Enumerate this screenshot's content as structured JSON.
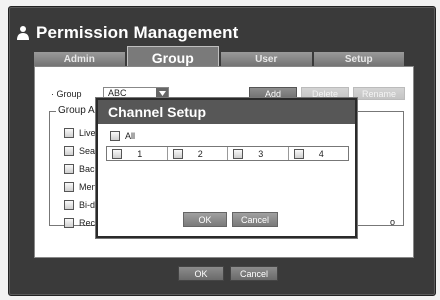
{
  "title": "Permission Management",
  "tabs": [
    "Admin",
    "Group",
    "User",
    "Setup"
  ],
  "active_tab": "Group",
  "group": {
    "label": "· Group",
    "value": "ABC"
  },
  "buttons": {
    "add": "Add",
    "delete": "Delete",
    "rename": "Rename",
    "ok": "OK",
    "cancel": "Cancel"
  },
  "group_box": {
    "legend": "Group A",
    "items": [
      "Live",
      "Sear",
      "Back",
      "Menu",
      "Bi-di",
      "Reco"
    ],
    "tail_text": "o"
  },
  "modal": {
    "title": "Channel Setup",
    "all_label": "All",
    "channels": [
      "1",
      "2",
      "3",
      "4"
    ],
    "ok": "OK",
    "cancel": "Cancel"
  }
}
